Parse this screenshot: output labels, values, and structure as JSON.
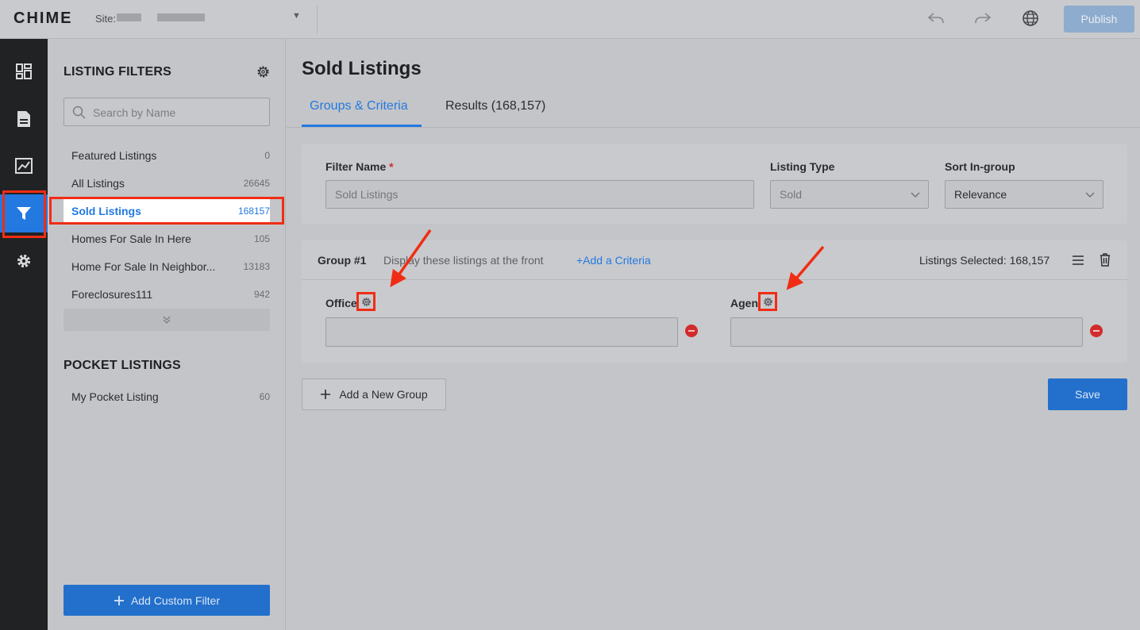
{
  "topbar": {
    "logo": "CHIME",
    "site_label": "Site:",
    "publish_label": "Publish",
    "icons": [
      "undo-icon",
      "redo-icon",
      "globe-icon"
    ]
  },
  "rail": {
    "items": [
      "dashboard-icon",
      "document-icon",
      "analytics-icon",
      "filter-icon",
      "settings-icon"
    ],
    "active": "filter-icon"
  },
  "sidebar": {
    "listing_filters_title": "LISTING FILTERS",
    "search_placeholder": "Search by Name",
    "items": [
      {
        "label": "Featured Listings",
        "count": "0"
      },
      {
        "label": "All Listings",
        "count": "26645"
      },
      {
        "label": "Sold Listings",
        "count": "168157"
      },
      {
        "label": "Homes For Sale In Here",
        "count": "105"
      },
      {
        "label": "Home For Sale In Neighbor...",
        "count": "13183"
      },
      {
        "label": "Foreclosures111",
        "count": "942"
      }
    ],
    "selected_index": 2,
    "pocket_title": "POCKET LISTINGS",
    "pocket_items": [
      {
        "label": "My Pocket Listing",
        "count": "60"
      }
    ],
    "add_custom_filter_label": "Add Custom Filter"
  },
  "main": {
    "title": "Sold Listings",
    "tabs": [
      {
        "label": "Groups & Criteria",
        "active": true
      },
      {
        "label": "Results (168,157)",
        "active": false
      }
    ],
    "filter": {
      "name_label": "Filter Name",
      "required_mark": "*",
      "name_value": "Sold Listings",
      "listing_type_label": "Listing Type",
      "listing_type_value": "Sold",
      "sort_label": "Sort In-group",
      "sort_value": "Relevance"
    },
    "group": {
      "title": "Group #1",
      "description": "Display these listings at the front",
      "add_criteria_label": "+Add a Criteria",
      "listings_selected": "Listings Selected: 168,157",
      "criteria": [
        {
          "label": "Office",
          "value": ""
        },
        {
          "label": "Agent",
          "value": ""
        }
      ]
    },
    "add_group_label": "Add a New Group",
    "save_label": "Save"
  },
  "colors": {
    "accent": "#2379e0",
    "annotation": "#f02d14",
    "danger": "#d32b2b"
  }
}
